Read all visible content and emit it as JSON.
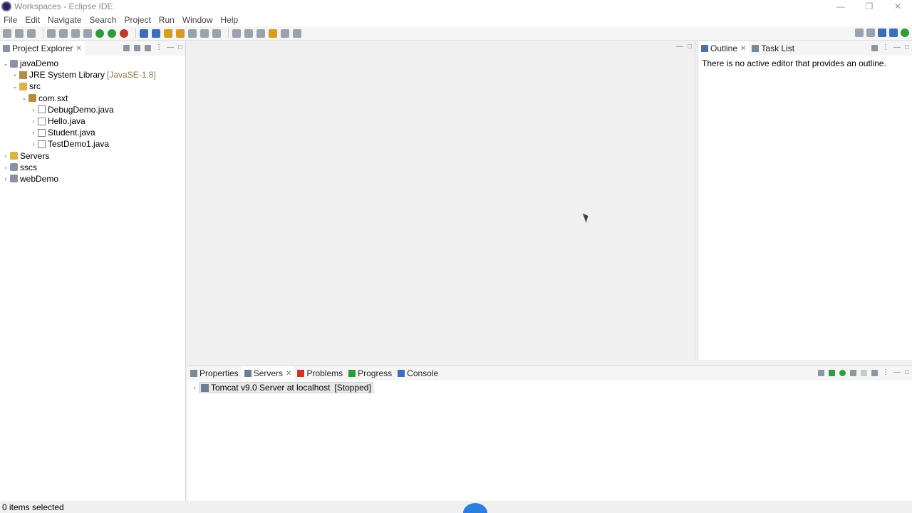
{
  "window": {
    "title": "Workspaces - Eclipse IDE",
    "controls": [
      "—",
      "❐",
      "✕"
    ]
  },
  "menu": [
    "File",
    "Edit",
    "Navigate",
    "Search",
    "Project",
    "Run",
    "Window",
    "Help"
  ],
  "project_explorer": {
    "tab_label": "Project Explorer",
    "tree": [
      {
        "label": "javaDemo",
        "depth": 0,
        "expanded": true,
        "icon": "project-icon"
      },
      {
        "label": "JRE System Library",
        "extra": "[JavaSE-1.8]",
        "depth": 1,
        "expanded": false,
        "icon": "library-icon"
      },
      {
        "label": "src",
        "depth": 1,
        "expanded": true,
        "icon": "folder-icon"
      },
      {
        "label": "com.sxt",
        "depth": 2,
        "expanded": true,
        "icon": "package-icon"
      },
      {
        "label": "DebugDemo.java",
        "depth": 3,
        "expanded": false,
        "icon": "java-file-icon"
      },
      {
        "label": "Hello.java",
        "depth": 3,
        "expanded": false,
        "icon": "java-file-icon"
      },
      {
        "label": "Student.java",
        "depth": 3,
        "expanded": false,
        "icon": "java-file-icon"
      },
      {
        "label": "TestDemo1.java",
        "depth": 3,
        "expanded": false,
        "icon": "java-file-icon"
      },
      {
        "label": "Servers",
        "depth": 0,
        "expanded": false,
        "icon": "folder-icon"
      },
      {
        "label": "sscs",
        "depth": 0,
        "expanded": false,
        "icon": "project-icon"
      },
      {
        "label": "webDemo",
        "depth": 0,
        "expanded": false,
        "icon": "project-icon"
      }
    ]
  },
  "outline": {
    "tabs": [
      "Outline",
      "Task List"
    ],
    "message": "There is no active editor that provides an outline."
  },
  "bottom_panel": {
    "tabs": [
      "Properties",
      "Servers",
      "Problems",
      "Progress",
      "Console"
    ],
    "active_tab": "Servers",
    "servers": [
      {
        "label": "Tomcat v9.0 Server at localhost",
        "status": "[Stopped]"
      }
    ]
  },
  "status": {
    "selection": "0 items selected"
  },
  "colors": {
    "background": "#f0f0f0",
    "panel": "#ffffff",
    "accent_blue": "#2b7fe0"
  }
}
